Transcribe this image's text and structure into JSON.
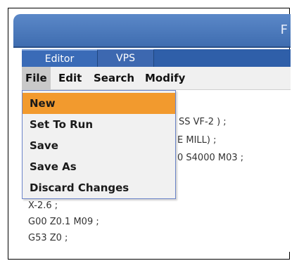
{
  "window": {
    "title_visible": "F"
  },
  "tabs": [
    {
      "label": "Editor",
      "active": true
    },
    {
      "label": "VPS",
      "active": false
    }
  ],
  "menubar": {
    "items": [
      "File",
      "Edit",
      "Search",
      "Modify"
    ],
    "open_menu": "File"
  },
  "file_menu": {
    "items": [
      "New",
      "Set To Run",
      "Save",
      "Save As",
      "Discard Changes"
    ],
    "highlighted": "New"
  },
  "editor": {
    "visible_fragments": [
      "SS VF-2 ) ;",
      "E MILL) ;",
      "0 S4000 M03 ;",
      "X-2.6 ;",
      "G00 Z0.1 M09 ;",
      "G53 Z0 ;"
    ]
  },
  "colors": {
    "titlebar": "#4b7bbf",
    "tabbar": "#2f5fa9",
    "menu_highlight": "#f29a2e",
    "dropdown_border": "#6b84c9"
  }
}
